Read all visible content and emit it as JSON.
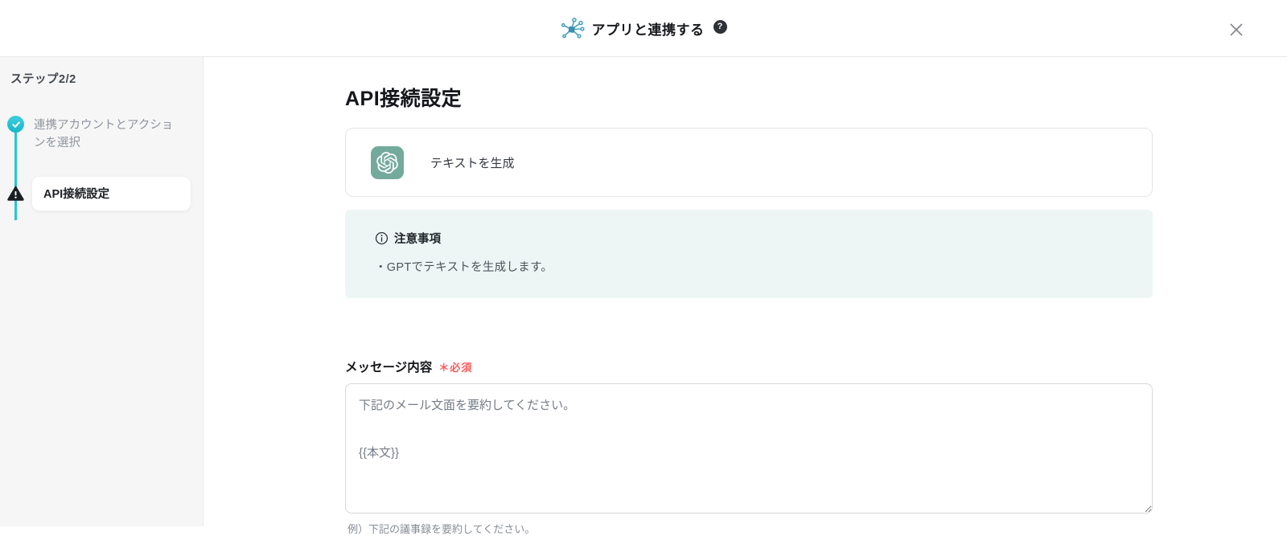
{
  "header": {
    "title": "アプリと連携する",
    "help_glyph": "?"
  },
  "sidebar": {
    "step_counter": "ステップ2/2",
    "steps": [
      {
        "label": "連携アカウントとアクションを選択",
        "state": "done"
      },
      {
        "label": "API接続設定",
        "state": "warning"
      }
    ]
  },
  "main": {
    "page_title": "API接続設定",
    "action_card": {
      "app_icon": "openai-logo",
      "icon_bg": "#74aa9c",
      "label": "テキストを生成"
    },
    "notice": {
      "title": "注意事項",
      "items": [
        "・GPTでテキストを生成します。"
      ]
    },
    "form": {
      "label": "メッセージ内容",
      "required_badge": "＊必須",
      "textarea_value": "下記のメール文面を要約してください。\n\n{{本文}}",
      "helper": "例）下記の議事録を要約してください。"
    }
  },
  "colors": {
    "accent_teal": "#2ac3d2",
    "notice_bg": "#edf6f4",
    "required_red": "#ff5b5b",
    "openai_green": "#74aa9c",
    "sidebar_bg": "#f6f6f7"
  }
}
